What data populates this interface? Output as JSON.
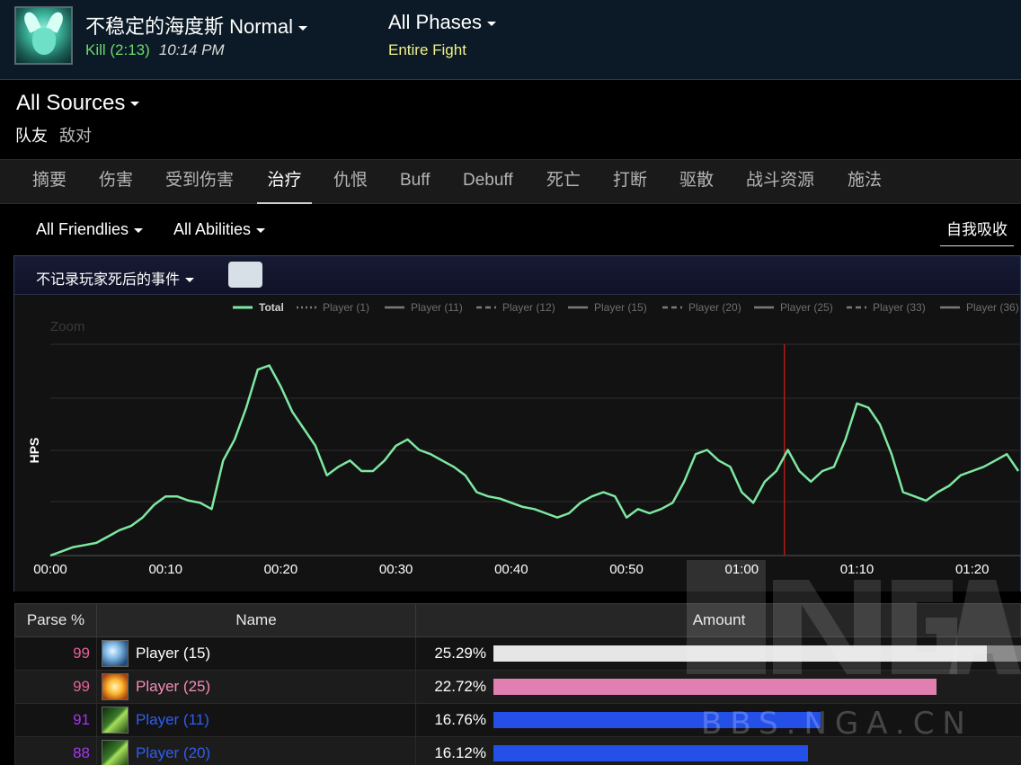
{
  "header": {
    "boss_name": "不稳定的海度斯 Normal",
    "kill": "Kill (2:13)",
    "time": "10:14 PM",
    "phases": "All Phases",
    "fight": "Entire Fight"
  },
  "sources": {
    "title": "All Sources",
    "tabs": [
      "队友",
      "敌对"
    ]
  },
  "nav": {
    "items": [
      "摘要",
      "伤害",
      "受到伤害",
      "治疗",
      "仇恨",
      "Buff",
      "Debuff",
      "死亡",
      "打断",
      "驱散",
      "战斗资源",
      "施法"
    ],
    "active": "治疗"
  },
  "filters": {
    "friendlies": "All Friendlies",
    "abilities": "All Abilities",
    "self_absorb": "自我吸收"
  },
  "chart_panel": {
    "death_option": "不记录玩家死后的事件",
    "zoom_label": "Zoom"
  },
  "chart_data": {
    "type": "line",
    "ylabel": "HPS",
    "legend": [
      "Total",
      "Player (1)",
      "Player (11)",
      "Player (12)",
      "Player (15)",
      "Player (20)",
      "Player (25)",
      "Player (33)",
      "Player (36)"
    ],
    "x_ticks": [
      "00:00",
      "00:10",
      "00:20",
      "00:30",
      "00:40",
      "00:50",
      "01:00",
      "01:10",
      "01:20"
    ],
    "x_range_seconds": [
      0,
      84
    ],
    "marker_seconds": 63.7,
    "series": [
      {
        "name": "Total",
        "color": "#7ee8a2",
        "x": [
          0,
          1,
          2,
          3,
          4,
          5,
          6,
          7,
          8,
          9,
          10,
          11,
          12,
          13,
          14,
          15,
          16,
          17,
          18,
          19,
          20,
          21,
          22,
          23,
          24,
          25,
          26,
          27,
          28,
          29,
          30,
          31,
          32,
          33,
          34,
          35,
          36,
          37,
          38,
          39,
          40,
          41,
          42,
          43,
          44,
          45,
          46,
          47,
          48,
          49,
          50,
          51,
          52,
          53,
          54,
          55,
          56,
          57,
          58,
          59,
          60,
          61,
          62,
          63,
          64,
          65,
          66,
          67,
          68,
          69,
          70,
          71,
          72,
          73,
          74,
          75,
          76,
          77,
          78,
          79,
          80,
          81,
          82,
          83,
          84
        ],
        "y": [
          0,
          2,
          4,
          5,
          6,
          9,
          12,
          14,
          18,
          24,
          28,
          28,
          26,
          25,
          22,
          45,
          55,
          70,
          88,
          90,
          80,
          68,
          60,
          52,
          38,
          42,
          45,
          40,
          40,
          45,
          52,
          55,
          50,
          48,
          45,
          42,
          38,
          30,
          28,
          27,
          25,
          23,
          22,
          20,
          18,
          20,
          25,
          28,
          30,
          28,
          18,
          22,
          20,
          22,
          25,
          35,
          48,
          50,
          45,
          42,
          30,
          25,
          35,
          40,
          50,
          40,
          35,
          40,
          42,
          55,
          72,
          70,
          62,
          48,
          30,
          28,
          26,
          30,
          33,
          38,
          40,
          42,
          45,
          48,
          40
        ]
      }
    ]
  },
  "table": {
    "headers": [
      "Parse %",
      "Name",
      "Amount"
    ],
    "rows": [
      {
        "parse": "99",
        "parse_color": "#e5609a",
        "name": "Player (15)",
        "name_color": "#ffffff",
        "pct": "25.29%",
        "bar_fraction": 0.2529,
        "bar_color": "#e6e6e6",
        "bg_fraction": 0.2763,
        "icon": "frost-icon"
      },
      {
        "parse": "99",
        "parse_color": "#e5609a",
        "name": "Player (25)",
        "name_color": "#f38bb8",
        "pct": "22.72%",
        "bar_fraction": 0.2272,
        "bar_color": "#e07fb0",
        "bg_fraction": 0,
        "icon": "holy-icon"
      },
      {
        "parse": "91",
        "parse_color": "#a335ee",
        "name": "Player (11)",
        "name_color": "#2f5df0",
        "pct": "16.76%",
        "bar_fraction": 0.1676,
        "bar_color": "#2450e8",
        "bg_fraction": 0,
        "icon": "nature-icon"
      },
      {
        "parse": "88",
        "parse_color": "#a335ee",
        "name": "Player (20)",
        "name_color": "#2f5df0",
        "pct": "16.12%",
        "bar_fraction": 0.1612,
        "bar_color": "#2450e8",
        "bg_fraction": 0,
        "icon": "nature-icon"
      }
    ]
  },
  "watermark": {
    "logo": "NGA",
    "url": "BBS.NGA.CN"
  }
}
